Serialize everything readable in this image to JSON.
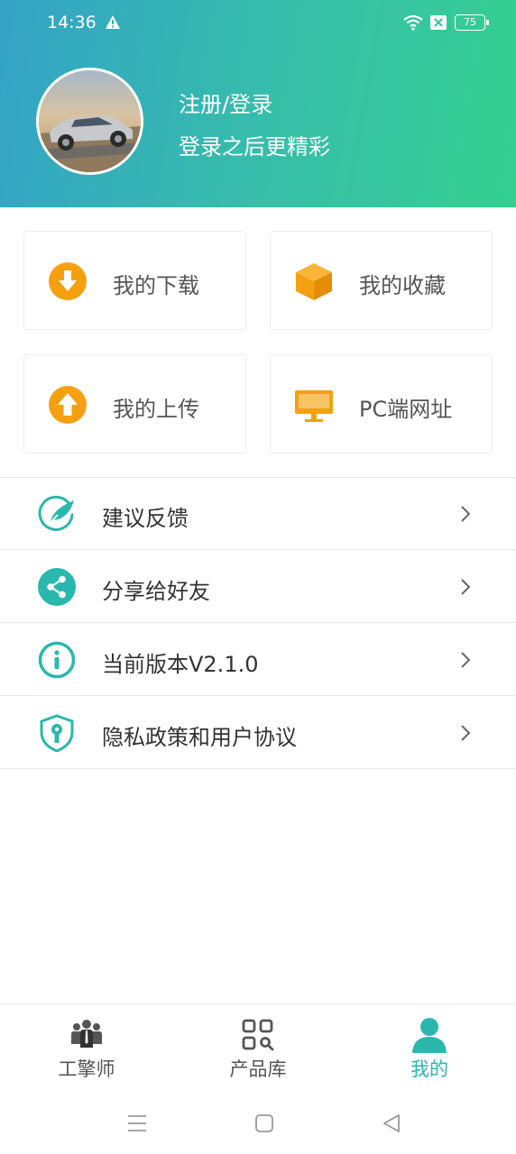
{
  "status_bar": {
    "time": "14:36",
    "battery": "75"
  },
  "profile": {
    "title": "注册/登录",
    "subtitle": "登录之后更精彩"
  },
  "cards": [
    {
      "label": "我的下载",
      "icon": "download-icon"
    },
    {
      "label": "我的收藏",
      "icon": "box-icon"
    },
    {
      "label": "我的上传",
      "icon": "upload-icon"
    },
    {
      "label": "PC端网址",
      "icon": "monitor-icon"
    }
  ],
  "menu": [
    {
      "label": "建议反馈",
      "icon": "feedback-icon"
    },
    {
      "label": "分享给好友",
      "icon": "share-icon"
    },
    {
      "label": "当前版本V2.1.0",
      "icon": "info-icon"
    },
    {
      "label": "隐私政策和用户协议",
      "icon": "shield-icon"
    }
  ],
  "tabs": [
    {
      "label": "工擎师",
      "icon": "people-icon"
    },
    {
      "label": "产品库",
      "icon": "grid-search-icon"
    },
    {
      "label": "我的",
      "icon": "person-icon",
      "active": true
    }
  ],
  "colors": {
    "accent": "#2ab8ad",
    "orange": "#f5a010",
    "header_start": "#33a3c7",
    "header_end": "#34d090"
  }
}
